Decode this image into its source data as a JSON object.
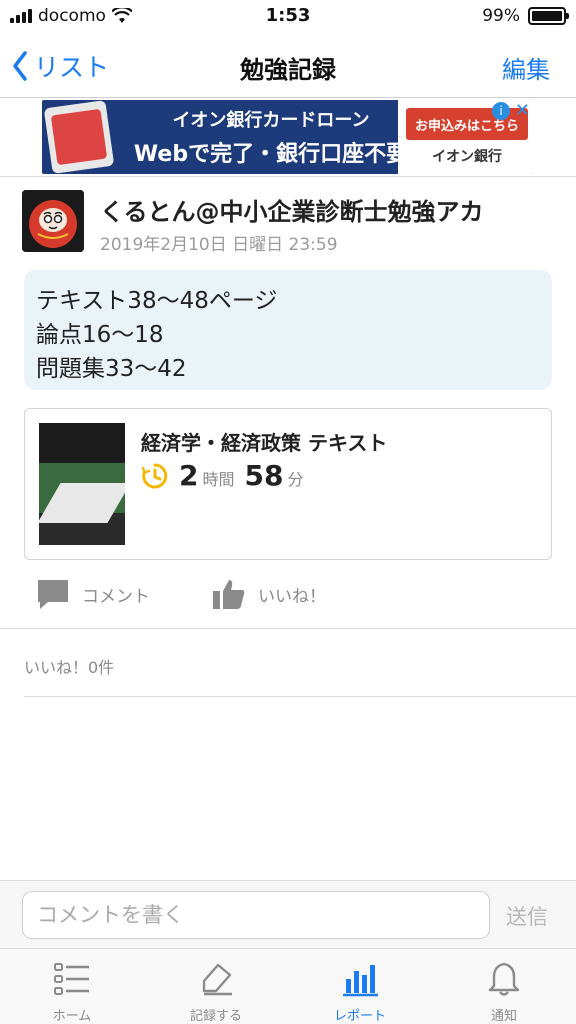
{
  "status_bar": {
    "carrier": "docomo",
    "time": "1:53",
    "battery": "99%"
  },
  "nav": {
    "back_label": "リスト",
    "title": "勉強記録",
    "edit_label": "編集"
  },
  "ad": {
    "headline": "イオン銀行カードローン",
    "subline": "Webで完了・銀行口座不要",
    "cta": "お申込みはこちら",
    "bank_name": "イオン銀行",
    "info_icon": "i",
    "close_icon": "✕"
  },
  "post": {
    "user_name": "くるとん@中小企業診断士勉強アカ",
    "date": "2019年2月10日 日曜日 23:59",
    "memo_lines": [
      "テキスト38〜48ページ",
      "論点16〜18",
      "問題集33〜42"
    ],
    "record": {
      "subject": "経済学・経済政策 テキスト",
      "hours": "2",
      "hours_unit": "時間",
      "minutes": "58",
      "minutes_unit": "分"
    },
    "actions": {
      "comment_label": "コメント",
      "like_label": "いいね！"
    },
    "like_count_text": "いいね！0件"
  },
  "comment_bar": {
    "placeholder": "コメントを書く",
    "send_label": "送信"
  },
  "tabs": [
    {
      "label": "ホーム",
      "icon": "list-icon",
      "active": false
    },
    {
      "label": "記録する",
      "icon": "pencil-icon",
      "active": false
    },
    {
      "label": "レポート",
      "icon": "bar-chart-icon",
      "active": true
    },
    {
      "label": "通知",
      "icon": "bell-icon",
      "active": false
    }
  ],
  "colors": {
    "accent": "#1a7cf0",
    "memo_bg": "#eaf3f8",
    "clock": "#f2b705"
  }
}
